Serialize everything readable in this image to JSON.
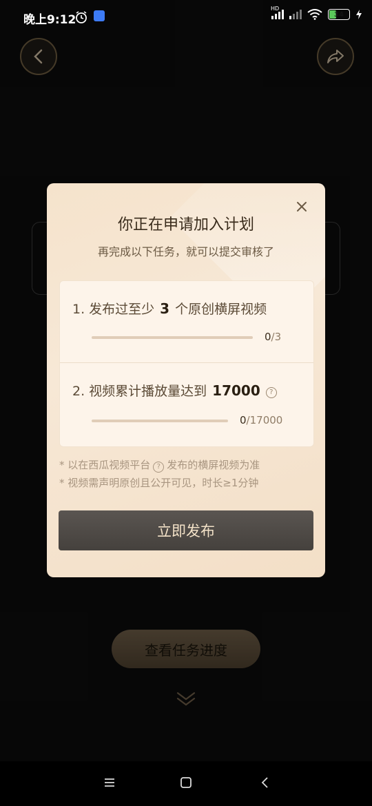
{
  "status_bar": {
    "time": "晚上9:12",
    "network_label": "HD",
    "battery": "34",
    "icons": [
      "alarm-icon",
      "app-notification-icon",
      "signal-icon",
      "signal-weak-icon",
      "wifi-icon",
      "battery-icon",
      "charging-icon"
    ]
  },
  "background": {
    "back_icon": "chevron-left-icon",
    "share_icon": "share-arrow-icon",
    "progress_button_label": "查看任务进度",
    "more_icon": "double-chevron-down-icon"
  },
  "dialog": {
    "title": "你正在申请加入计划",
    "subtitle": "再完成以下任务，就可以提交审核了",
    "tasks": [
      {
        "prefix": "1. 发布过至少",
        "target": "3",
        "suffix": "个原创横屏视频",
        "current": "0",
        "total": "/3",
        "progress": 0
      },
      {
        "prefix": "2. 视频累计播放量达到",
        "target": "17000",
        "suffix": "",
        "current": "0",
        "total": "/17000",
        "progress": 0
      }
    ],
    "note_1_prefix": "* 以在西瓜视频平台",
    "note_1_suffix": "发布的横屏视频为准",
    "note_2": "* 视频需声明原创且公开可见，时长≥1分钟",
    "publish_button_label": "立即发布"
  },
  "colors": {
    "dialog_bg": "#f5e3cc",
    "button_dark": "#4e4a46",
    "button_text": "#f3e2c8",
    "accent_gold": "#b08a5e"
  }
}
